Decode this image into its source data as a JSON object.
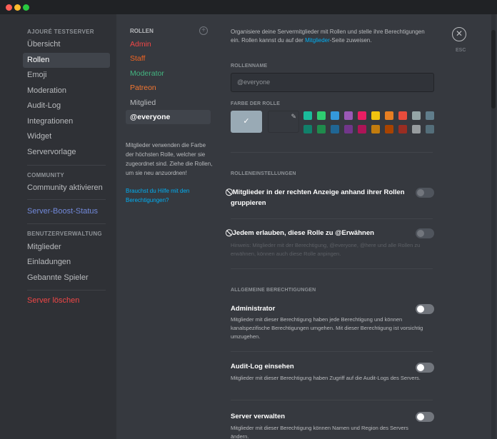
{
  "window": {
    "traffic_lights": [
      "#ff5f57",
      "#febc2e",
      "#28c840"
    ]
  },
  "sidebar": {
    "section1": "AJOURÉ TESTSERVER",
    "items1": [
      "Übersicht",
      "Rollen",
      "Emoji",
      "Moderation",
      "Audit-Log",
      "Integrationen",
      "Widget",
      "Servervorlage"
    ],
    "selected": "Rollen",
    "section2": "COMMUNITY",
    "community_item": "Community aktivieren",
    "boost_item": "Server-Boost-Status",
    "section3": "BENUTZERVERWALTUNG",
    "items3": [
      "Mitglieder",
      "Einladungen",
      "Gebannte Spieler"
    ],
    "delete_item": "Server löschen"
  },
  "roles": {
    "header": "ROLLEN",
    "add_icon": "plus-circle-icon",
    "list": [
      {
        "name": "Admin",
        "color": "#f04747"
      },
      {
        "name": "Staff",
        "color": "#f26522"
      },
      {
        "name": "Moderator",
        "color": "#43b581"
      },
      {
        "name": "Patreon",
        "color": "#f57731"
      },
      {
        "name": "Mitglied",
        "color": "#b9bbbe"
      },
      {
        "name": "@everyone",
        "color": "#ffffff"
      }
    ],
    "selected": "@everyone",
    "hint": "Mitglieder verwenden die Farbe der höchsten Rolle, welcher sie zugeordnet sind. Ziehe die Rollen, um sie neu anzuordnen!",
    "help_link": "Brauchst du Hilfe mit den Berechtigungen?"
  },
  "main": {
    "intro_before": "Organisiere deine Servermitglieder mit Rollen und stelle ihre Berechtigungen ein. Rollen kannst du auf der ",
    "intro_link": "Mitglieder",
    "intro_after": "-Seite zuweisen.",
    "close_label": "ESC",
    "rolename_label": "ROLLENNAME",
    "rolename_value": "@everyone",
    "color_label": "FARBE DER ROLLE",
    "color_default": "#99aab5",
    "color_custom": "#36393f",
    "palette_row1": [
      "#1abc9c",
      "#2ecc71",
      "#3498db",
      "#9b59b6",
      "#e91e63",
      "#f1c40f",
      "#e67e22",
      "#e74c3c",
      "#95a5a6",
      "#607d8b"
    ],
    "palette_row2": [
      "#11806a",
      "#1f8b4c",
      "#206694",
      "#71368a",
      "#ad1457",
      "#c27c0e",
      "#a84300",
      "#992d22",
      "#979c9f",
      "#546e7a"
    ],
    "role_settings_label": "ROLLENEINSTELLUNGEN",
    "setting1_title": "Mitglieder in der rechten Anzeige anhand ihrer Rollen gruppieren",
    "setting2_title": "Jedem erlauben, diese Rolle zu @Erwähnen",
    "setting2_desc": "Hinweis: Mitglieder mit der Berechtigung, @everyone, @here und alle Rollen zu erwähnen, können auch diese Rolle anpingen.",
    "general_label": "ALLGEMEINE BERECHTIGUNGEN",
    "perms": [
      {
        "title": "Administrator",
        "desc": "Mitglieder mit dieser Berechtigung haben jede Berechtigung und können kanalspezifische Berechtigungen umgehen. Mit dieser Berechtigung ist vorsichtig umzugehen."
      },
      {
        "title": "Audit-Log einsehen",
        "desc": "Mitglieder mit dieser Berechtigung haben Zugriff auf die Audit-Logs des Servers."
      },
      {
        "title": "Server verwalten",
        "desc": "Mitglieder mit dieser Berechtigung können Namen und Region des Servers ändern."
      }
    ]
  }
}
